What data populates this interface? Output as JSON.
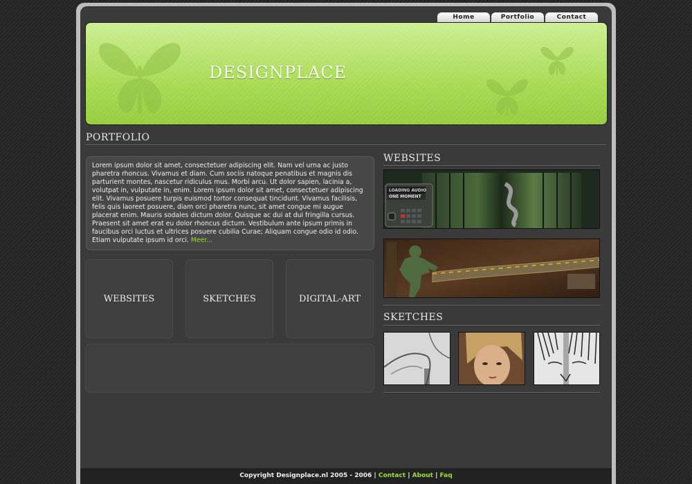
{
  "nav": {
    "items": [
      "Home",
      "Portfolio",
      "Contact"
    ]
  },
  "header": {
    "title": "DESIGNPLACE"
  },
  "main": {
    "heading": "PORTFOLIO",
    "intro_text": "Lorem ipsum dolor sit amet, consectetuer adipiscing elit. Nam vel urna ac justo pharetra rhoncus. Vivamus et diam. Cum sociis natoque penatibus et magnis dis parturient montes, nascetur ridiculus mus. Morbi arcu. Ut dolor sapien, lacinia a, volutpat in, vulputate in, enim. Lorem ipsum dolor sit amet, consectetuer adipiscing elit. Vivamus posuere turpis euismod tortor consequat tincidunt. Vivamus facilisis, felis quis laoreet posuere, diam orci pharetra nunc, sit amet congue mi augue placerat enim. Mauris sodales dictum dolor. Quisque ac dui at dui fringilla cursus. Praesent sit amet erat eu dolor rhoncus dictum. Vestibulum ante ipsum primis in faucibus orci luctus et ultrices posuere cubilia Curae; Aliquam congue odio id odio. Etiam vulputate ipsum id orci.",
    "more_link": "Meer...",
    "categories": [
      "WEBSITES",
      "SKETCHES",
      "DIGITAL-ART"
    ]
  },
  "sidebar": {
    "websites_heading": "WEBSITES",
    "loading_text_1": "LOADING AUDIO",
    "loading_text_2": "ONE MOMENT",
    "sketches_heading": "SKETCHES"
  },
  "footer": {
    "copyright": "Copyright Designplace.nl 2005 - 2006",
    "sep": "|",
    "links": [
      "Contact",
      "About",
      "Faq"
    ]
  },
  "colors": {
    "accent": "#9fdc3a",
    "header_green": "#a9db55",
    "background": "#3a3a3a"
  }
}
